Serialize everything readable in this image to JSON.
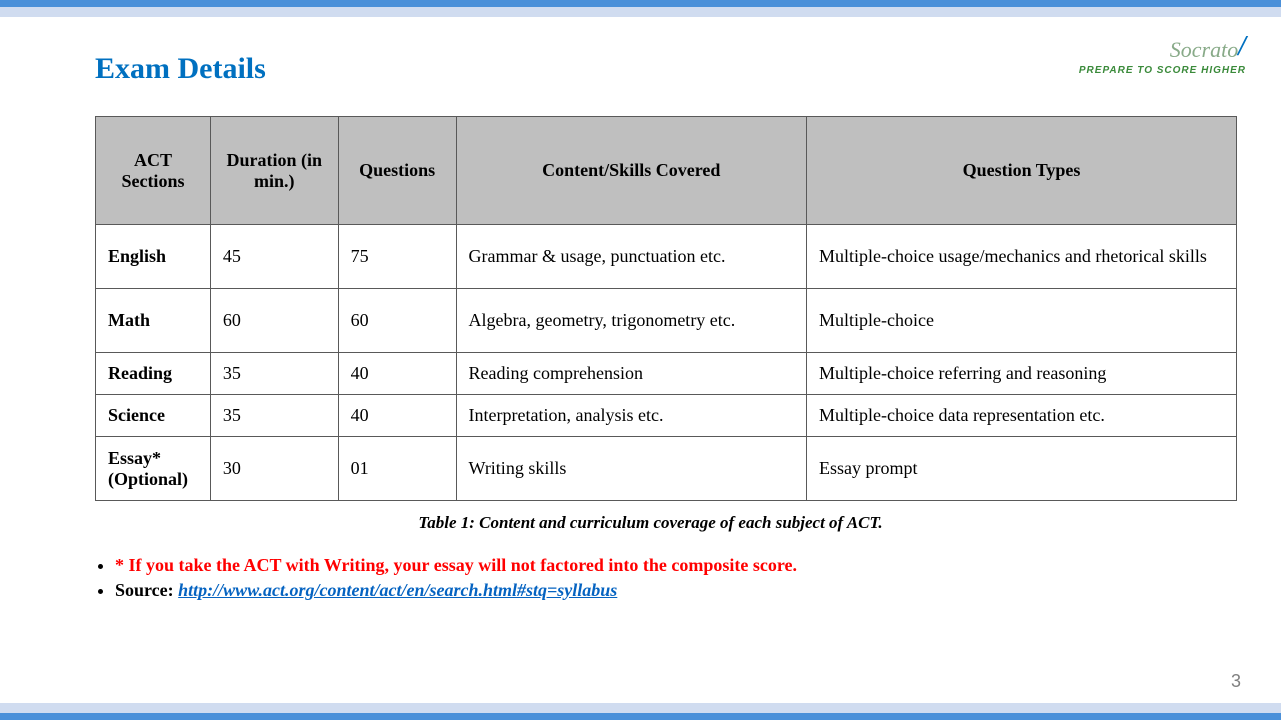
{
  "title": "Exam Details",
  "logo": {
    "brand": "Socrato",
    "tagline": "PREPARE TO SCORE HIGHER"
  },
  "table": {
    "headers": {
      "sections": "ACT Sections",
      "duration": "Duration (in min.)",
      "questions": "Questions",
      "content": "Content/Skills  Covered",
      "types": "Question  Types"
    },
    "rows": [
      {
        "section": "English",
        "duration": "45",
        "questions": "75",
        "content": "Grammar & usage, punctuation etc.",
        "types": "Multiple-choice usage/mechanics and rhetorical skills",
        "tall": true
      },
      {
        "section": "Math",
        "duration": "60",
        "questions": "60",
        "content": "Algebra, geometry, trigonometry etc.",
        "types": "Multiple-choice",
        "tall": true
      },
      {
        "section": "Reading",
        "duration": "35",
        "questions": "40",
        "content": "Reading comprehension",
        "types": "Multiple-choice referring and reasoning",
        "tall": false
      },
      {
        "section": "Science",
        "duration": "35",
        "questions": "40",
        "content": "Interpretation, analysis etc.",
        "types": "Multiple-choice data representation etc.",
        "tall": false
      },
      {
        "section": "Essay* (Optional)",
        "duration": "30",
        "questions": "01",
        "content": "Writing skills",
        "types": "Essay prompt",
        "tall": true
      }
    ]
  },
  "caption": "Table 1: Content and curriculum coverage of each subject of ACT.",
  "notes": {
    "warning": "* If you take the ACT with Writing,  your essay will not factored into the composite score.",
    "source_label": " Source: ",
    "source_url": "http://www.act.org/content/act/en/search.html#stq=syllabus"
  },
  "page_number": "3"
}
